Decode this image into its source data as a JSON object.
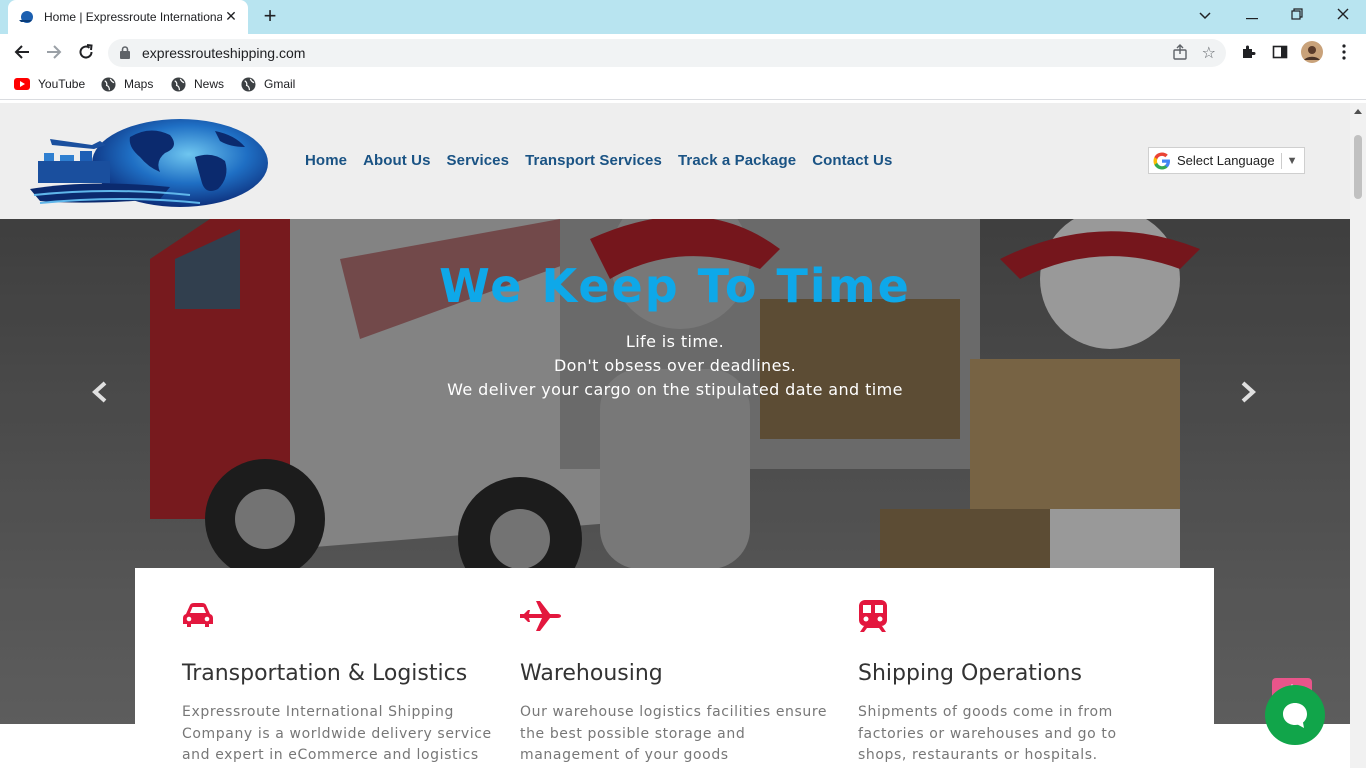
{
  "browser": {
    "tab_title": "Home | Expressroute International",
    "url": "expressrouteshipping.com",
    "bookmarks": [
      {
        "label": "YouTube",
        "icon": "youtube-icon"
      },
      {
        "label": "Maps",
        "icon": "globe-icon"
      },
      {
        "label": "News",
        "icon": "globe-icon"
      },
      {
        "label": "Gmail",
        "icon": "globe-icon"
      }
    ]
  },
  "site": {
    "nav": [
      "Home",
      "About Us",
      "Services",
      "Transport Services",
      "Track a Package",
      "Contact Us"
    ],
    "language_select": "Select Language",
    "accent_color": "#0ea8e9",
    "nav_color": "#1a5384",
    "icon_color": "#e3173e"
  },
  "hero": {
    "heading": "We Keep To Time",
    "lines": [
      "Life is time.",
      "Don't obsess over deadlines.",
      "We deliver your cargo on the stipulated date and time"
    ]
  },
  "services": [
    {
      "icon": "car-icon",
      "title": "Transportation & Logistics",
      "desc": "Expressroute International Shipping Company is a worldwide delivery service and expert in eCommerce and logistics in"
    },
    {
      "icon": "airplane-icon",
      "title": "Warehousing",
      "desc": "Our warehouse logistics facilities ensure the best possible storage and management of your goods"
    },
    {
      "icon": "train-icon",
      "title": "Shipping Operations",
      "desc": "Shipments of goods come in from factories or warehouses and go to shops, restaurants or hospitals."
    }
  ]
}
